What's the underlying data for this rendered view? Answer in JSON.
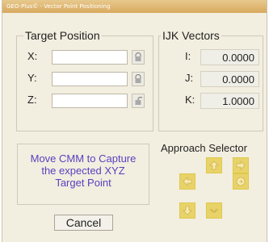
{
  "window": {
    "title": "GEO-Plus© - Vector Point Positioning"
  },
  "target_position": {
    "title": "Target Position",
    "rows": [
      {
        "label": "X:",
        "value": ""
      },
      {
        "label": "Y:",
        "value": ""
      },
      {
        "label": "Z:",
        "value": ""
      }
    ]
  },
  "ijk_vectors": {
    "title": "IJK Vectors",
    "rows": [
      {
        "label": "I:",
        "value": "0.0000"
      },
      {
        "label": "J:",
        "value": "0.0000"
      },
      {
        "label": "K:",
        "value": "1.0000"
      }
    ]
  },
  "message": {
    "line1": "Move CMM to Capture",
    "line2": "the expected XYZ",
    "line3": "Target Point"
  },
  "approach": {
    "title": "Approach Selector"
  },
  "actions": {
    "cancel_label": "Cancel"
  },
  "colors": {
    "approach_button": "#e8d36a",
    "message_text": "#5b3fbf",
    "title_bar": "#d8a95e"
  },
  "icons": [
    "lock-icon",
    "unlock-icon",
    "approach-arrow-icon"
  ]
}
